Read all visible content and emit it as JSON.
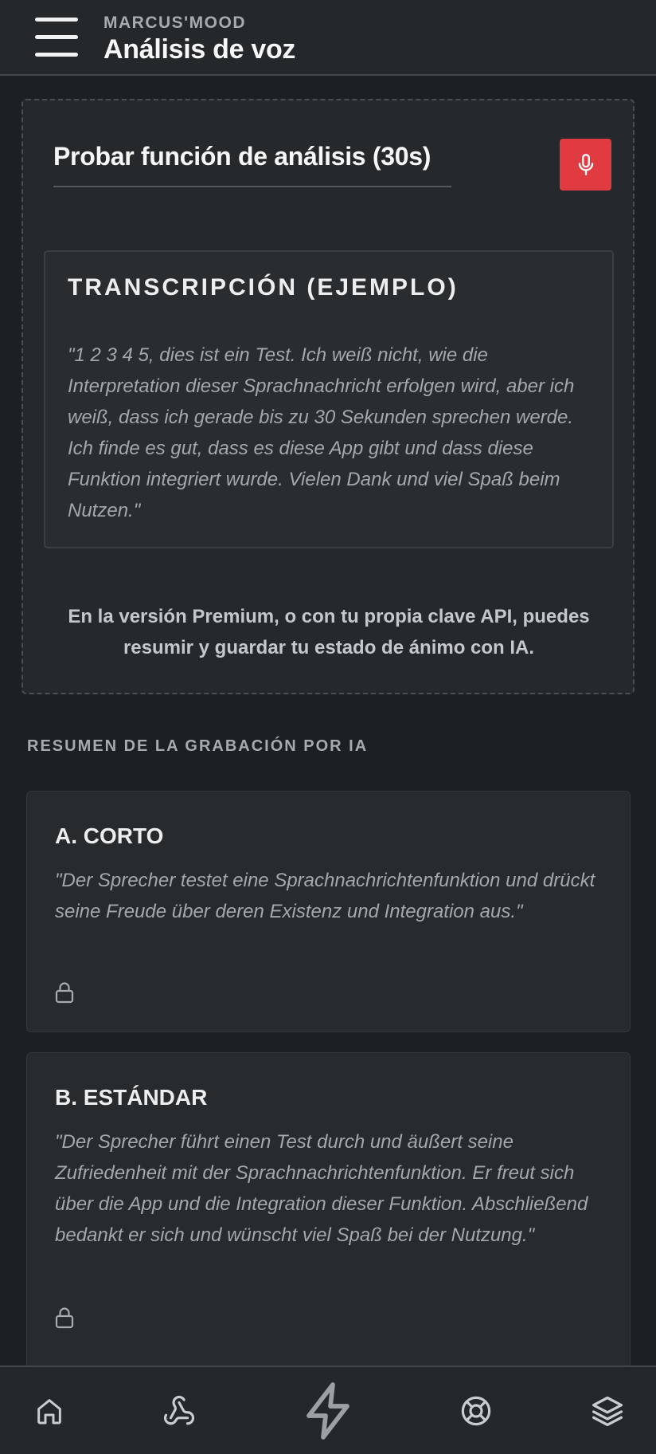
{
  "header": {
    "app_name": "MARCUS'MOOD",
    "title": "Análisis de voz",
    "menu_icon": "hamburger-menu-icon"
  },
  "test_panel": {
    "title": "Probar función de análisis (30s)",
    "mic_icon": "microphone-icon",
    "mic_color": "#e13b42",
    "transcript_heading": "TRANSCRIPCIÓN (EJEMPLO)",
    "transcript_text": "\"1 2 3 4 5, dies ist ein Test. Ich weiß nicht, wie die Interpretation dieser Sprachnachricht erfolgen wird, aber ich weiß, dass ich gerade bis zu 30 Sekunden sprechen werde. Ich finde es gut, dass es diese App gibt und dass diese Funktion integriert wurde. Vielen Dank und viel Spaß beim Nutzen.\"",
    "premium_note": "En la versión Premium, o con tu propia clave API, puedes resumir y guardar tu estado de ánimo con IA."
  },
  "summary": {
    "section_label": "RESUMEN DE LA GRABACIÓN POR IA",
    "cards": [
      {
        "title": "A. CORTO",
        "text": "\"Der Sprecher testet eine Sprachnachrichtenfunktion und drückt seine Freude über deren Existenz und Integration aus.\"",
        "icon": "lock-icon"
      },
      {
        "title": "B. ESTÁNDAR",
        "text": "\"Der Sprecher führt einen Test durch und äußert seine Zufriedenheit mit der Sprachnachrichtenfunktion. Er freut sich über die App und die Integration dieser Funktion. Abschließend bedankt er sich und wünscht viel Spaß bei der Nutzung.\"",
        "icon": "lock-icon"
      }
    ]
  },
  "bottom_nav": {
    "items": [
      {
        "icon": "home-icon"
      },
      {
        "icon": "webhook-icon"
      },
      {
        "icon": "lightning-bolt-icon"
      },
      {
        "icon": "lifebuoy-icon"
      },
      {
        "icon": "layers-icon"
      }
    ]
  },
  "colors": {
    "background": "#1d2022",
    "panel": "#26292c",
    "accent_red": "#e13b42"
  }
}
